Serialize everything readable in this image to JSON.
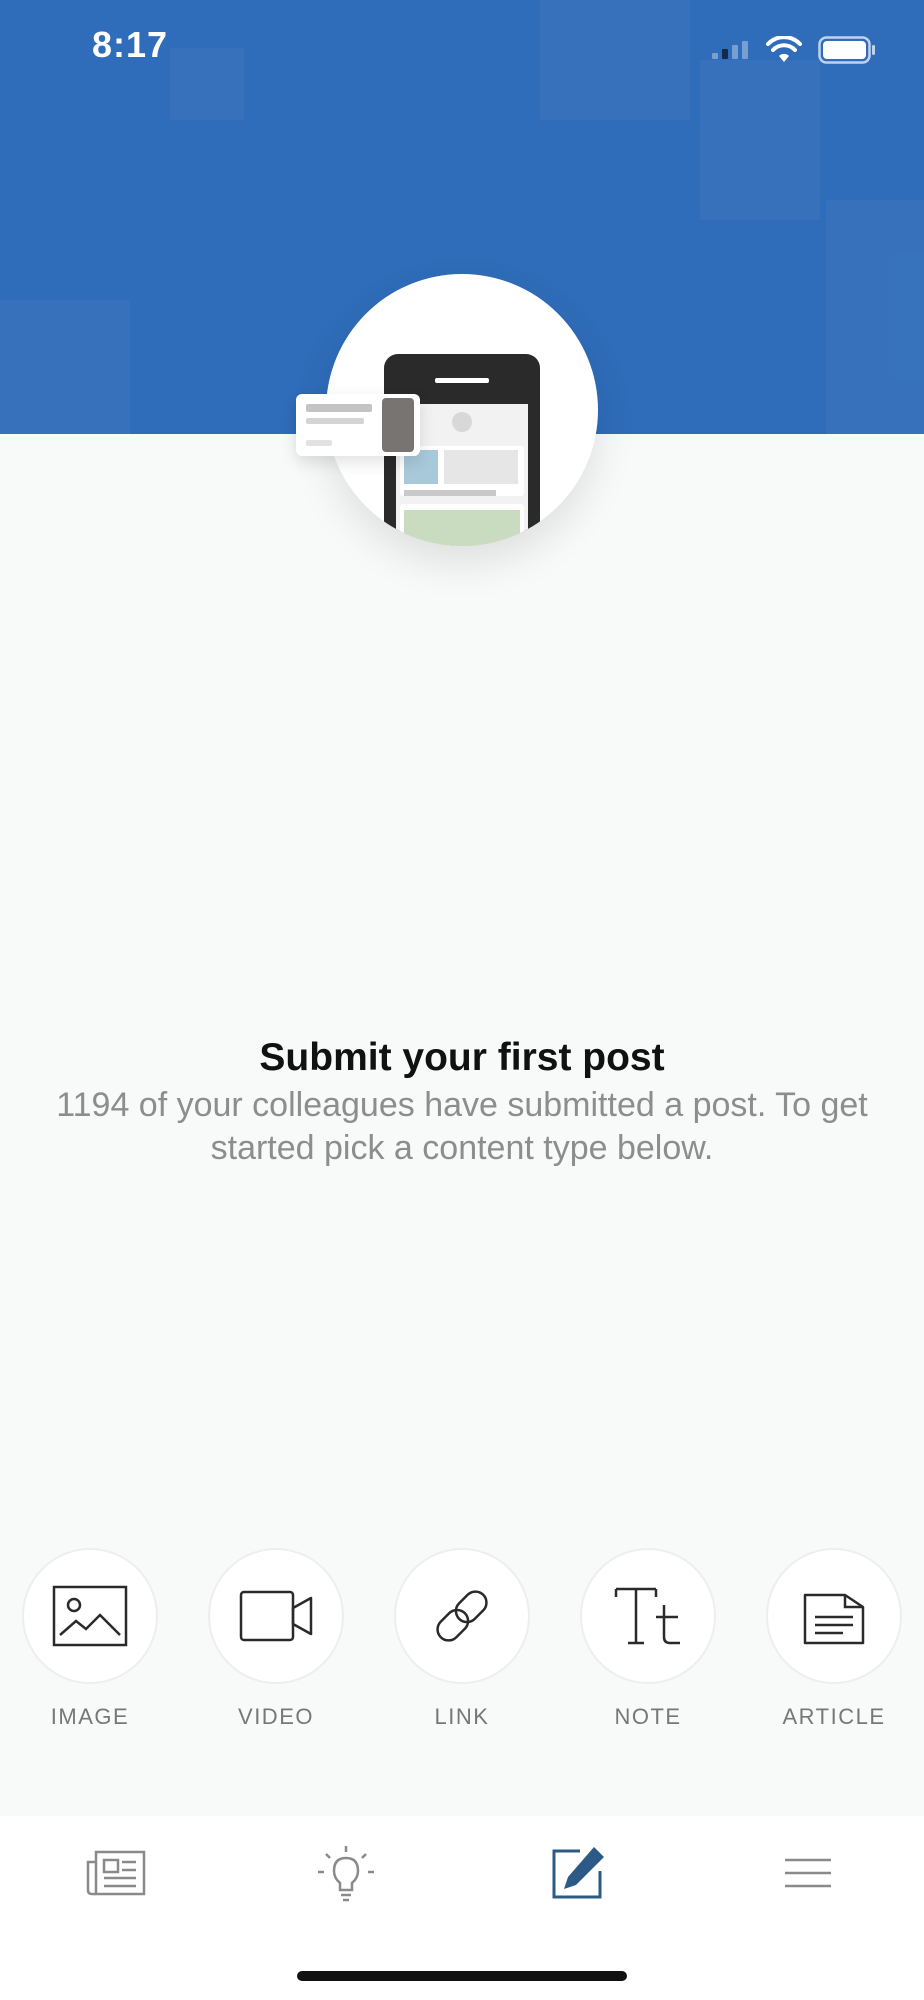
{
  "status_bar": {
    "time": "8:17"
  },
  "empty_state": {
    "title": "Submit your first post",
    "subtitle": "1194 of your colleagues have submitted a post. To get started pick a content type below."
  },
  "content_types": [
    {
      "label": "IMAGE",
      "icon": "image-icon"
    },
    {
      "label": "VIDEO",
      "icon": "video-camera-icon"
    },
    {
      "label": "LINK",
      "icon": "link-icon"
    },
    {
      "label": "NOTE",
      "icon": "text-tt-icon"
    },
    {
      "label": "ARTICLE",
      "icon": "document-icon"
    }
  ],
  "bottom_nav": [
    {
      "icon": "newspaper-icon",
      "active": false
    },
    {
      "icon": "lightbulb-icon",
      "active": false
    },
    {
      "icon": "pencil-edit-icon",
      "active": true
    },
    {
      "icon": "hamburger-menu-icon",
      "active": false
    }
  ],
  "colors": {
    "header_blue": "#2f6cb9",
    "active_nav": "#2c5a86",
    "inactive_nav": "#8a8a8a",
    "background": "#f8f9f9"
  }
}
